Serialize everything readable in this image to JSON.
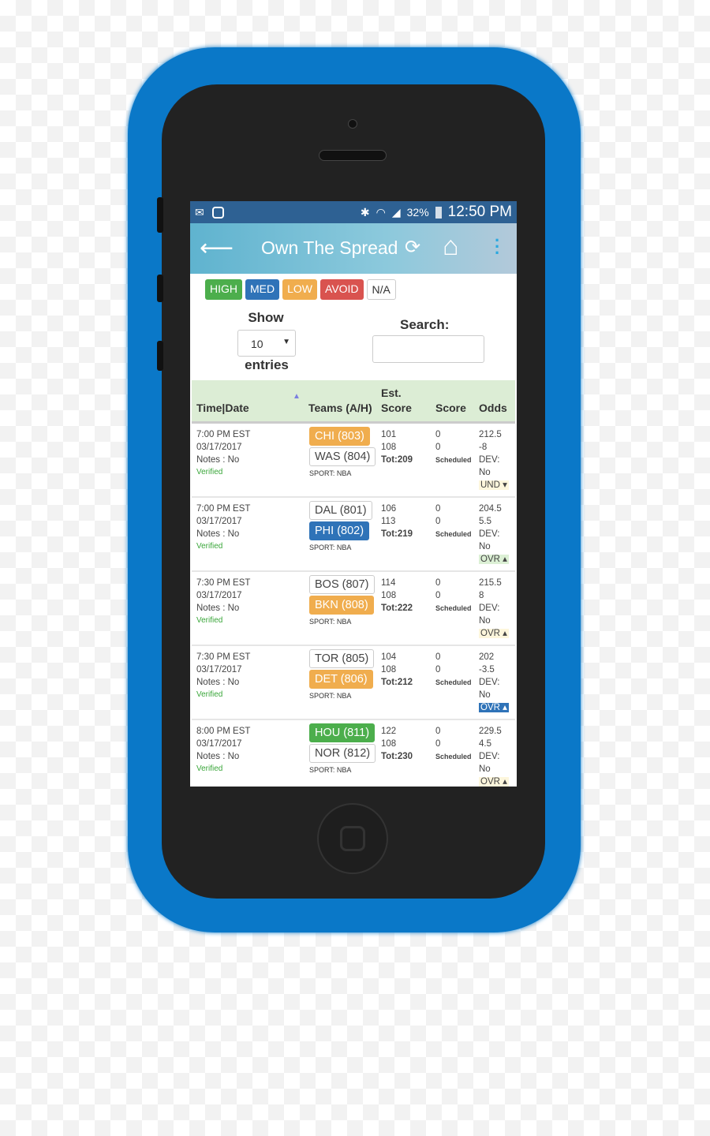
{
  "status_bar": {
    "battery": "32%",
    "time": "12:50 PM",
    "icons": [
      "mail-icon",
      "instagram-icon",
      "bluetooth-icon",
      "wifi-icon",
      "signal-icon",
      "battery-icon"
    ]
  },
  "app_bar": {
    "title": "Own The Spread",
    "icons": [
      "back-arrow-icon",
      "refresh-icon",
      "home-icon",
      "more-vert-icon"
    ]
  },
  "legend": [
    {
      "label": "HIGH",
      "color": "#4cae4c"
    },
    {
      "label": "MED",
      "color": "#2f73b8"
    },
    {
      "label": "LOW",
      "color": "#f0ad4e"
    },
    {
      "label": "AVOID",
      "color": "#d9534f"
    },
    {
      "label": "N/A",
      "color": "#ffffff"
    }
  ],
  "controls": {
    "show_label": "Show",
    "entries_value": "10",
    "entries_label": "entries",
    "search_label": "Search:",
    "search_value": ""
  },
  "table": {
    "headers": [
      "Time|Date",
      "Teams (A/H)",
      "Est.",
      "Score",
      "Score",
      "Odds"
    ],
    "rows": [
      {
        "time": "7:00 PM EST",
        "date": "03/17/2017",
        "notes": "Notes : No",
        "status": "Verified",
        "away": "CHI (803)",
        "away_level": "LOW",
        "home": "WAS (804)",
        "home_level": "N/A",
        "sport": "SPORT: NBA",
        "est_away": "101",
        "est_home": "108",
        "est_total": "Tot:209",
        "score_away": "0",
        "score_home": "0",
        "score_status": "Scheduled",
        "total": "212.5",
        "spread": "-8",
        "dev_label": "DEV:",
        "dev": "No",
        "ou": "UND ▾",
        "ou_bg": "#fdf6dc",
        "ou_fg": "#444"
      },
      {
        "time": "7:00 PM EST",
        "date": "03/17/2017",
        "notes": "Notes : No",
        "status": "Verified",
        "away": "DAL (801)",
        "away_level": "N/A",
        "home": "PHI (802)",
        "home_level": "MED",
        "sport": "SPORT: NBA",
        "est_away": "106",
        "est_home": "113",
        "est_total": "Tot:219",
        "score_away": "0",
        "score_home": "0",
        "score_status": "Scheduled",
        "total": "204.5",
        "spread": "5.5",
        "dev_label": "DEV:",
        "dev": "No",
        "ou": "OVR ▴",
        "ou_bg": "#dcf0d5",
        "ou_fg": "#444"
      },
      {
        "time": "7:30 PM EST",
        "date": "03/17/2017",
        "notes": "Notes : No",
        "status": "Verified",
        "away": "BOS (807)",
        "away_level": "N/A",
        "home": "BKN (808)",
        "home_level": "LOW",
        "sport": "SPORT: NBA",
        "est_away": "114",
        "est_home": "108",
        "est_total": "Tot:222",
        "score_away": "0",
        "score_home": "0",
        "score_status": "Scheduled",
        "total": "215.5",
        "spread": "8",
        "dev_label": "DEV:",
        "dev": "No",
        "ou": "OVR ▴",
        "ou_bg": "#fdf6dc",
        "ou_fg": "#444"
      },
      {
        "time": "7:30 PM EST",
        "date": "03/17/2017",
        "notes": "Notes : No",
        "status": "Verified",
        "away": "TOR (805)",
        "away_level": "N/A",
        "home": "DET (806)",
        "home_level": "LOW",
        "sport": "SPORT: NBA",
        "est_away": "104",
        "est_home": "108",
        "est_total": "Tot:212",
        "score_away": "0",
        "score_home": "0",
        "score_status": "Scheduled",
        "total": "202",
        "spread": "-3.5",
        "dev_label": "DEV:",
        "dev": "No",
        "ou": "OVR ▴",
        "ou_bg": "#2f73b8",
        "ou_fg": "#ffffff"
      },
      {
        "time": "8:00 PM EST",
        "date": "03/17/2017",
        "notes": "Notes : No",
        "status": "Verified",
        "away": "HOU (811)",
        "away_level": "HIGH",
        "home": "NOR (812)",
        "home_level": "N/A",
        "sport": "SPORT: NBA",
        "est_away": "122",
        "est_home": "108",
        "est_total": "Tot:230",
        "score_away": "0",
        "score_home": "0",
        "score_status": "Scheduled",
        "total": "229.5",
        "spread": "4.5",
        "dev_label": "DEV:",
        "dev": "No",
        "ou": "OVR ▴",
        "ou_bg": "#fdf6dc",
        "ou_fg": "#444"
      }
    ]
  }
}
